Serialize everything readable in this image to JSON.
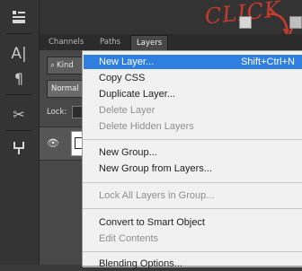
{
  "annotation": {
    "text": "CLICK"
  },
  "panel": {
    "tabs": [
      {
        "label": "Channels"
      },
      {
        "label": "Paths"
      },
      {
        "label": "Layers"
      }
    ],
    "filter_label": "Kind",
    "blend_mode": "Normal",
    "lock_label": "Lock:"
  },
  "menu": {
    "items": [
      {
        "label": "New Layer...",
        "shortcut": "Shift+Ctrl+N",
        "state": "highlighted"
      },
      {
        "label": "Copy CSS",
        "shortcut": "",
        "state": "enabled"
      },
      {
        "label": "Duplicate Layer...",
        "shortcut": "",
        "state": "enabled"
      },
      {
        "label": "Delete Layer",
        "shortcut": "",
        "state": "disabled"
      },
      {
        "label": "Delete Hidden Layers",
        "shortcut": "",
        "state": "disabled"
      },
      {
        "label": "New Group...",
        "shortcut": "",
        "state": "enabled"
      },
      {
        "label": "New Group from Layers...",
        "shortcut": "",
        "state": "enabled"
      },
      {
        "label": "Lock All Layers in Group...",
        "shortcut": "",
        "state": "disabled"
      },
      {
        "label": "Convert to Smart Object",
        "shortcut": "",
        "state": "enabled"
      },
      {
        "label": "Edit Contents",
        "shortcut": "",
        "state": "disabled"
      },
      {
        "label": "Blending Options...",
        "shortcut": "",
        "state": "enabled"
      }
    ]
  },
  "colors": {
    "menu_highlight": "#2f7fe0",
    "annotation": "#c83a2e"
  }
}
